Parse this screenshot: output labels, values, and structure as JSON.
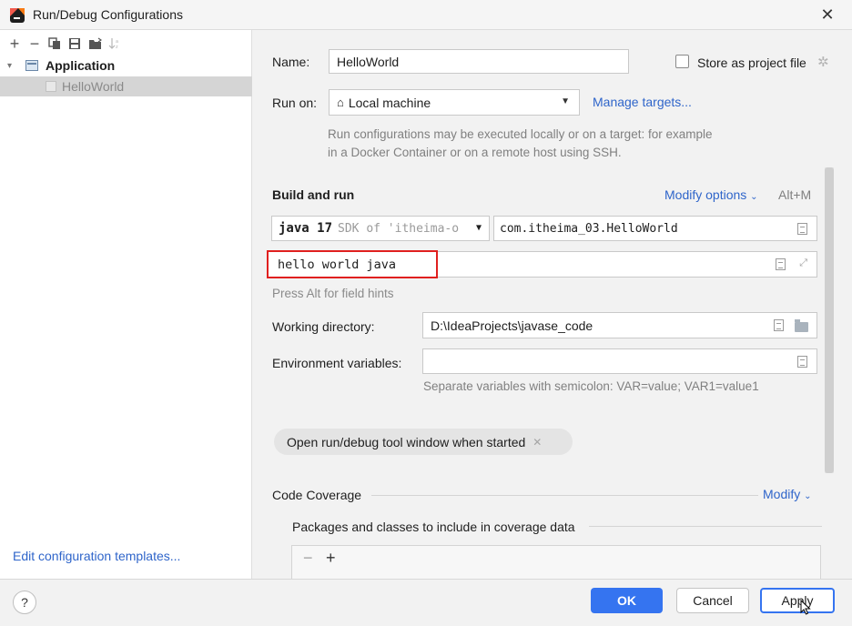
{
  "window": {
    "title": "Run/Debug Configurations",
    "close_glyph": "✕"
  },
  "left": {
    "toolbar": [
      {
        "name": "add-icon",
        "glyph": "+"
      },
      {
        "name": "remove-icon",
        "glyph": "−"
      },
      {
        "name": "copy-icon",
        "glyph": ""
      },
      {
        "name": "save-icon",
        "glyph": ""
      },
      {
        "name": "move-to-folder-icon",
        "glyph": ""
      },
      {
        "name": "sort-icon",
        "glyph": ""
      }
    ],
    "tree_app_label": "Application",
    "tree_item_label": "HelloWorld",
    "edit_templates": "Edit configuration templates..."
  },
  "form": {
    "name_label": "Name:",
    "name_value": "HelloWorld",
    "store_label": "Store as project file",
    "run_on_label": "Run on:",
    "run_on_value": "Local machine",
    "manage_targets": "Manage targets...",
    "run_on_hint": "Run configurations may be executed locally or on a target: for example in a Docker Container or on a remote host using SSH.",
    "build_title": "Build and run",
    "modify_options": "Modify options",
    "modify_shortcut": "Alt+M",
    "sdk_version": "java 17",
    "sdk_detail": "SDK of 'itheima-o",
    "main_class": "com.itheima_03.HelloWorld",
    "program_args": "hello world java",
    "field_hints": "Press Alt for field hints",
    "wd_label": "Working directory:",
    "wd_value": "D:\\IdeaProjects\\javase_code",
    "env_label": "Environment variables:",
    "env_value": "",
    "env_hint": "Separate variables with semicolon: VAR=value; VAR1=value1",
    "pill_label": "Open run/debug tool window when started",
    "coverage_title": "Code Coverage",
    "coverage_modify": "Modify",
    "packages_title": "Packages and classes to include in coverage data"
  },
  "buttons": {
    "help": "?",
    "ok": "OK",
    "cancel": "Cancel",
    "apply": "Apply"
  },
  "colors": {
    "accent": "#3574f0",
    "highlight": "#e0201f",
    "link": "#2f65ca"
  }
}
